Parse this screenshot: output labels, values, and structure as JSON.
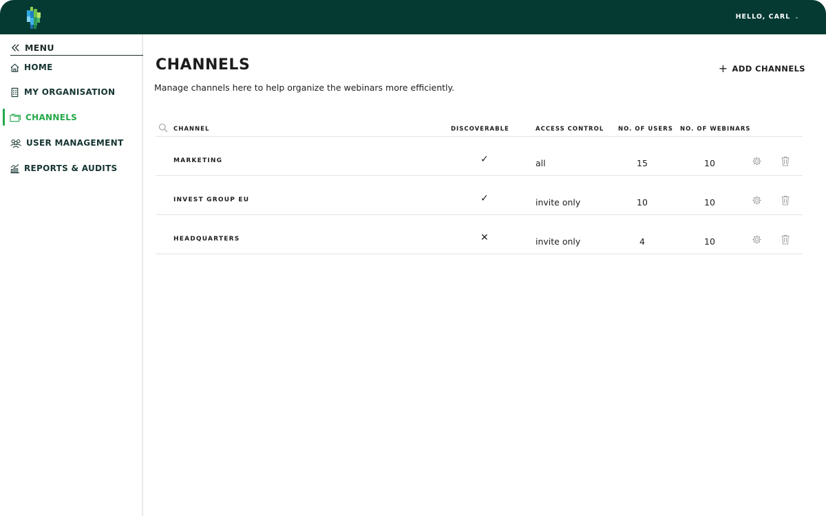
{
  "header": {
    "greeting": "HELLO, CARL",
    "caret": "⌄",
    "logo": "brand-logo",
    "colors": {
      "bar": "#053a33",
      "accent": "#24a84a"
    }
  },
  "sidebar": {
    "menu_label": "MENU",
    "items": [
      {
        "label": "HOME",
        "icon": "home-icon",
        "active": false
      },
      {
        "label": "MY ORGANISATION",
        "icon": "building-icon",
        "active": false
      },
      {
        "label": "CHANNELS",
        "icon": "folder-icon",
        "active": true
      },
      {
        "label": "USER MANAGEMENT",
        "icon": "users-icon",
        "active": false
      },
      {
        "label": "REPORTS & AUDITS",
        "icon": "chart-icon",
        "active": false
      }
    ]
  },
  "main": {
    "title": "CHANNELS",
    "description": "Manage channels here to help organize the webinars more efficiently.",
    "add_button": "ADD CHANNELS",
    "add_icon": "+",
    "table": {
      "headers": [
        "CHANNEL",
        "DISCOVERABLE",
        "ACCESS CONTROL",
        "NO. OF USERS",
        "NO. OF WEBINARS"
      ],
      "rows": [
        {
          "channel": "MARKETING",
          "discoverable": "✓",
          "access": "all",
          "users": "15",
          "webinars": "10"
        },
        {
          "channel": "INVEST GROUP EU",
          "discoverable": "✓",
          "access": "invite only",
          "users": "10",
          "webinars": "10"
        },
        {
          "channel": "HEADQUARTERS",
          "discoverable": "✕",
          "access": "invite only",
          "users": "4",
          "webinars": "10"
        }
      ]
    }
  }
}
